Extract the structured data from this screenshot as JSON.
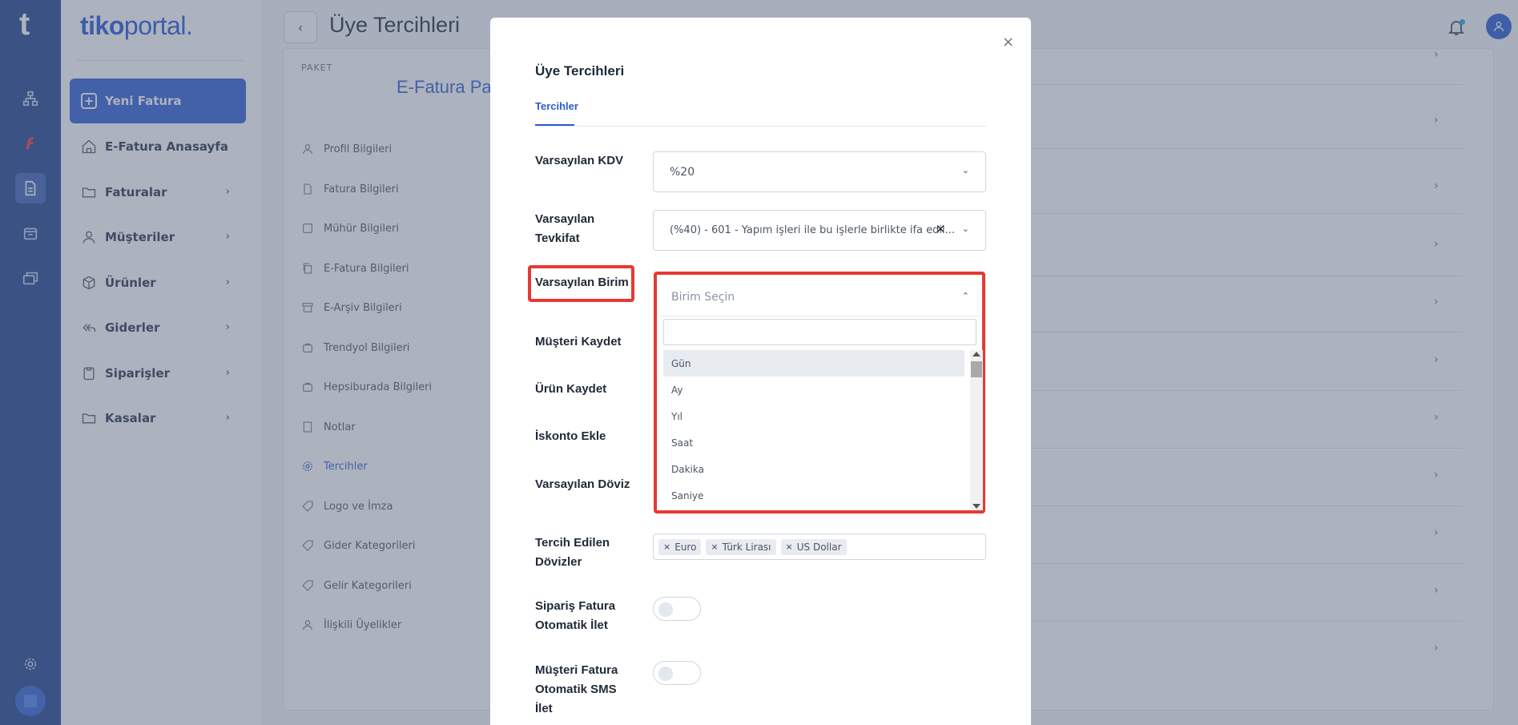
{
  "app": {
    "rail_logo": "t",
    "brand_part1": "tiko",
    "brand_part2": "portal."
  },
  "sidebar": {
    "new_invoice": "Yeni Fatura",
    "items": [
      {
        "label": "E-Fatura Anasayfa"
      },
      {
        "label": "Faturalar"
      },
      {
        "label": "Müşteriler"
      },
      {
        "label": "Ürünler"
      },
      {
        "label": "Giderler"
      },
      {
        "label": "Siparişler"
      },
      {
        "label": "Kasalar"
      }
    ]
  },
  "header": {
    "title": "Üye Tercihleri"
  },
  "background": {
    "package_label": "PAKET",
    "package_name": "E-Fatura Paketi",
    "menu": [
      "Profil Bilgileri",
      "Fatura Bilgileri",
      "Mühür Bilgileri",
      "E-Fatura Bilgileri",
      "E-Arşiv Bilgileri",
      "Trendyol Bilgileri",
      "Hepsiburada Bilgileri",
      "Notlar",
      "Tercihler",
      "Logo ve İmza",
      "Gider Kategorileri",
      "Gelir Kategorileri",
      "İlişkili Üyelikler"
    ]
  },
  "modal": {
    "title": "Üye Tercihleri",
    "tab": "Tercihler",
    "close": "×",
    "fields": {
      "kdv_label": "Varsayılan KDV",
      "kdv_value": "%20",
      "tevkifat_label_1": "Varsayılan",
      "tevkifat_label_2": "Tevkifat",
      "tevkifat_value": "(%40) - 601 - Yapım işleri ile bu işlerle birlikte ifa edil...",
      "tevkifat_clear": "×",
      "birim_label": "Varsayılan Birim",
      "birim_placeholder": "Birim Seçin",
      "musteri_kaydet": "Müşteri Kaydet",
      "urun_kaydet": "Ürün Kaydet",
      "iskonto": "İskonto Ekle",
      "doviz": "Varsayılan Döviz",
      "tercih_doviz_1": "Tercih Edilen",
      "tercih_doviz_2": "Dövizler",
      "siparis_1": "Sipariş Fatura",
      "siparis_2": "Otomatik İlet",
      "sms_1": "Müşteri Fatura",
      "sms_2": "Otomatik SMS",
      "sms_3": "İlet"
    },
    "birim_options": [
      "Gün",
      "Ay",
      "Yıl",
      "Saat",
      "Dakika",
      "Saniye"
    ],
    "currencies": [
      "Euro",
      "Türk Lirası",
      "US Dollar"
    ],
    "tag_remove": "×",
    "siparis_toggle": false,
    "sms_toggle": false
  },
  "colors": {
    "brand_blue": "#2a5cd2",
    "rail": "#1c3f8c",
    "highlight": "#e53935"
  }
}
